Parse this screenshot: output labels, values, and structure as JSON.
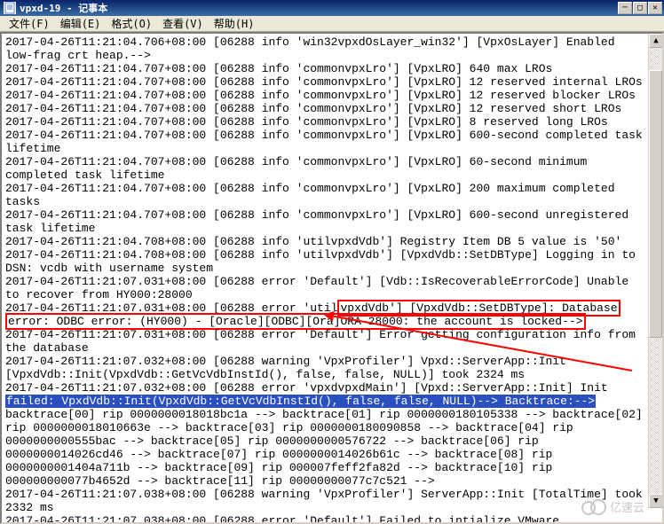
{
  "window": {
    "title": "vpxd-19 - 记事本"
  },
  "menu": {
    "file": "文件(F)",
    "edit": "编辑(E)",
    "format": "格式(O)",
    "view": "查看(V)",
    "help": "帮助(H)"
  },
  "controls": {
    "minimize": "─",
    "maximize": "□",
    "close": "✕"
  },
  "log": {
    "l01": "2017-04-26T11:21:04.706+08:00 [06288 info 'win32vpxdOsLayer_win32'] [VpxOsLayer] Enabled low-frag crt heap.-->",
    "l02": "2017-04-26T11:21:04.707+08:00 [06288 info 'commonvpxLro'] [VpxLRO] 640 max LROs",
    "l03": "2017-04-26T11:21:04.707+08:00 [06288 info 'commonvpxLro'] [VpxLRO] 12 reserved internal LROs",
    "l04": "2017-04-26T11:21:04.707+08:00 [06288 info 'commonvpxLro'] [VpxLRO] 12 reserved blocker LROs",
    "l05": "2017-04-26T11:21:04.707+08:00 [06288 info 'commonvpxLro'] [VpxLRO] 12 reserved short LROs",
    "l06": "2017-04-26T11:21:04.707+08:00 [06288 info 'commonvpxLro'] [VpxLRO] 8 reserved long LROs",
    "l07": "2017-04-26T11:21:04.707+08:00 [06288 info 'commonvpxLro'] [VpxLRO] 600-second completed task lifetime",
    "l08": "2017-04-26T11:21:04.707+08:00 [06288 info 'commonvpxLro'] [VpxLRO] 60-second minimum completed task lifetime",
    "l09": "2017-04-26T11:21:04.707+08:00 [06288 info 'commonvpxLro'] [VpxLRO] 200 maximum completed tasks",
    "l10": "2017-04-26T11:21:04.707+08:00 [06288 info 'commonvpxLro'] [VpxLRO] 600-second unregistered task lifetime",
    "l11": "2017-04-26T11:21:04.708+08:00 [06288 info 'utilvpxdVdb'] Registry Item DB 5 value is '50'",
    "l12": "2017-04-26T11:21:04.708+08:00 [06288 info 'utilvpxdVdb'] [VpxdVdb::SetDBType] Logging in to DSN: vcdb with username system",
    "l13": "2017-04-26T11:21:07.031+08:00 [06288 error 'Default'] [Vdb::IsRecoverableErrorCode] Unable to recover from HY000:28000",
    "l14a": "2017-04-26T11:21:07.031+08:00 [06288 error 'util",
    "l14b": "vpxdVdb'] [VpxdVdb::SetDBType]: Database",
    "l15a": "error: ODBC error: (HY000) - [Oracle][ODBC][Ora]",
    "l15b": "ORA-28000: the account is locked-->",
    "l16": "2017-04-26T11:21:07.031+08:00 [06288 error 'Default'] Error getting configuration info from the database",
    "l17": "2017-04-26T11:21:07.032+08:00 [06288 warning 'VpxProfiler'] Vpxd::ServerApp::Init [VpxdVdb::Init(VpxdVdb::GetVcVdbInstId(), false, false, NULL)] took 2324 ms",
    "l18": "2017-04-26T11:21:07.032+08:00 [06288 error 'vpxdvpxdMain'] [Vpxd::ServerApp::Init] Init ",
    "l19": "failed: VpxdVdb::Init(VpxdVdb::GetVcVdbInstId(), false, false, NULL)--> Backtrace:-->",
    "l20": "backtrace[00] rip 0000000018018bc1a --> backtrace[01] rip 0000000180105338 --> backtrace[02] rip 0000000018010663e --> backtrace[03] rip 0000000180090858 --> backtrace[04] rip 0000000000555bac --> backtrace[05] rip 0000000000576722 --> backtrace[06] rip 0000000014026cd46 --> backtrace[07] rip 0000000014026b61c --> backtrace[08] rip 0000000001404a711b --> backtrace[09] rip 000007feff2fa82d --> backtrace[10] rip 000000000077b4652d --> backtrace[11] rip 00000000077c7c521 -->",
    "l21": "2017-04-26T11:21:07.038+08:00 [06288 warning 'VpxProfiler'] ServerApp::Init [TotalTime] took 2332 ms",
    "l22": "2017-04-26T11:21:07.038+08:00 [06288 error 'Default'] Failed to intialize VMware"
  },
  "watermark": {
    "text": "亿速云"
  }
}
